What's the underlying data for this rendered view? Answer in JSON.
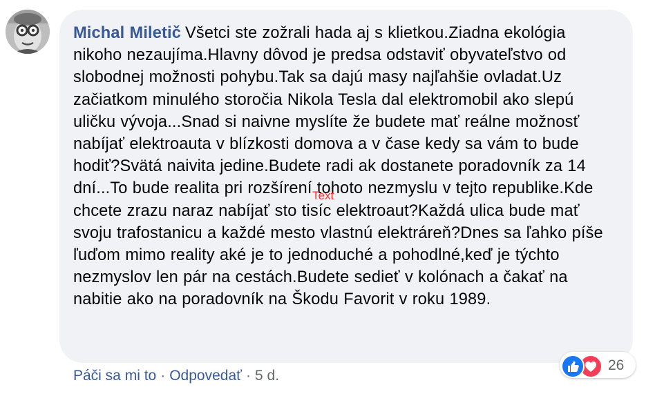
{
  "comment": {
    "author": "Michal Miletič",
    "text": "Všetci ste zožrali hada aj s klietkou.Ziadna ekológia nikoho nezaujíma.Hlavny dôvod je predsa odstaviť obyvateľstvo od slobodnej možnosti pohybu.Tak sa dajú masy najľahšie ovladat.Uz začiatkom minulého storočia Nikola Tesla dal elektromobil ako slepú uličku vývoja...Snad si naivne myslíte že budete mať reálne možnosť nabíjať elektroauta v blízkosti domova a v čase kedy sa vám to bude hodiť?Svätá naivita jedine.Budete radi ak dostanete poradovník za 14 dní...To bude realita pri rozšírení tohoto nezmyslu v tejto republike.Kde chcete zrazu naraz nabíjať sto tisíc elektroaut?Každá ulica bude mať svoju trafostanicu a každé mesto vlastnú elektráreň?Dnes sa ľahko píše ľuďom mimo reality aké je to jednoduché a pohodlné,keď je týchto nezmyslov len pár na cestách.Budete sedieť v kolónach a čakať na nabitie ako na poradovník na Škodu Favorit v roku 1989."
  },
  "overlay": {
    "label": "Text"
  },
  "actions": {
    "like_label": "Páči sa mi to",
    "separator": "·",
    "reply_label": "Odpovedať",
    "time": "5 d."
  },
  "reactions": {
    "icons": [
      "like-icon",
      "love-icon"
    ],
    "count": "26"
  },
  "colors": {
    "author": "#385898",
    "bubble": "#f0f2f5",
    "like": "#1877f2",
    "love": "#f33e58",
    "overlay_label": "#ff2b2b"
  }
}
